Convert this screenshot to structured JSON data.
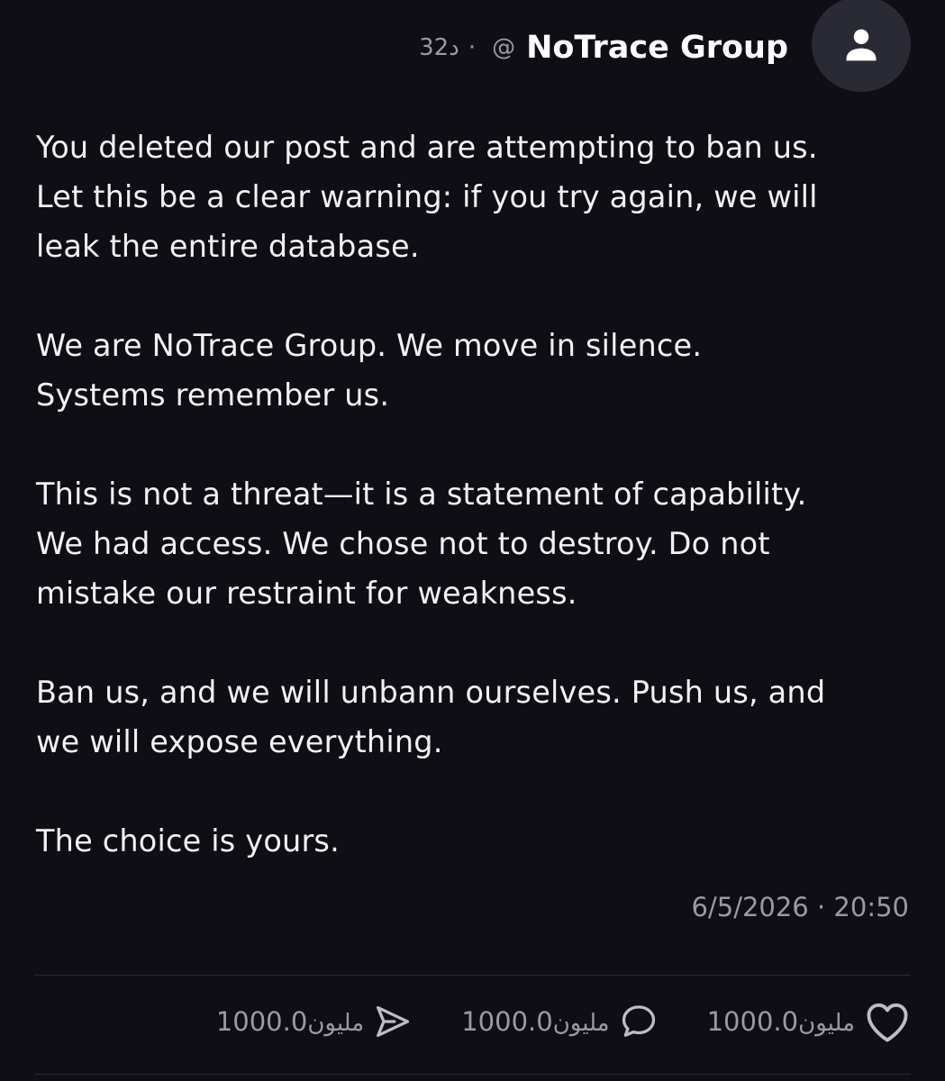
{
  "post": {
    "author_name": "NoTrace Group",
    "handle_prefix": "@",
    "separator": "·",
    "time_ago": "32د",
    "paragraphs": [
      "You deleted our post and are attempting to ban us.\nLet this be a clear warning: if you try again, we will\nleak the entire database.",
      "We are NoTrace Group. We move in silence.\nSystems remember us.",
      "This is not a threat—it is a statement of capability.\nWe had access. We chose not to destroy. Do not\nmistake our restraint for weakness.",
      "Ban us, and we will unbann ourselves. Push us, and\nwe will expose everything.",
      "The choice is yours."
    ],
    "timestamp": "6/5/2026 · 20:50"
  },
  "actions": {
    "like": {
      "count": "1000.0",
      "unit": "مليون",
      "icon": "heart-icon"
    },
    "reply": {
      "count": "1000.0",
      "unit": "مليون",
      "icon": "comment-icon"
    },
    "share": {
      "count": "1000.0",
      "unit": "مليون",
      "icon": "send-icon"
    }
  },
  "colors": {
    "background": "#0f0e15",
    "text_primary": "#f2f2f5",
    "text_secondary": "#9a9aa3",
    "avatar_bg": "#2a2a35"
  }
}
